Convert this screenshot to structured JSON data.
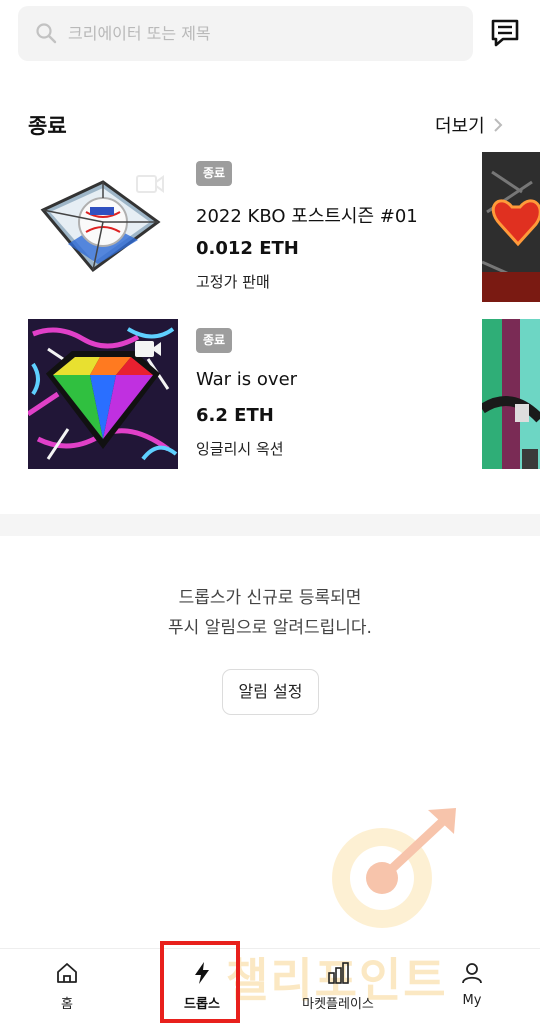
{
  "search": {
    "placeholder": "크리에이터 또는 제목"
  },
  "section": {
    "title": "종료",
    "more_label": "더보기"
  },
  "items": [
    {
      "badge": "종료",
      "title": "2022 KBO 포스트시즌 #01",
      "price": "0.012 ETH",
      "sale_type": "고정가 판매"
    },
    {
      "badge": "종료",
      "title": "War is over",
      "price": "6.2 ETH",
      "sale_type": "잉글리시 옥션"
    }
  ],
  "notice": {
    "line1": "드롭스가 신규로 등록되면",
    "line2": "푸시 알림으로 알려드립니다."
  },
  "alarm_button": "알림 설정",
  "nav": [
    {
      "label": "홈",
      "icon": "home-icon"
    },
    {
      "label": "드롭스",
      "icon": "lightning-icon",
      "active": true
    },
    {
      "label": "마켓플레이스",
      "icon": "bar-chart-icon"
    },
    {
      "label": "My",
      "icon": "person-icon"
    }
  ],
  "watermark_text": "챌리포인트",
  "colors": {
    "badge": "#9d9d9d",
    "highlight": "#e8201c",
    "watermark": "#f6a23a"
  }
}
